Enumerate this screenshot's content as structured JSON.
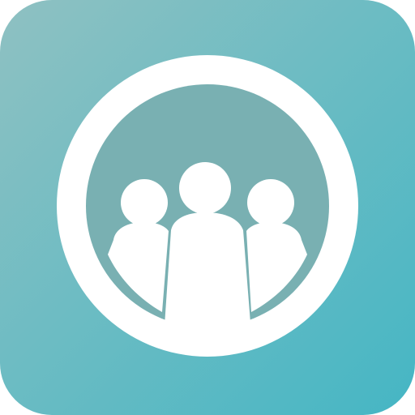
{
  "app_icon": {
    "icon_name": "group-people-icon",
    "colors": {
      "tile_gradient_start": "#8fc1c2",
      "tile_gradient_end": "#45b6c4",
      "ring": "#ffffff",
      "inner_disc": "#79b0b2",
      "figures": "#ffffff"
    }
  }
}
